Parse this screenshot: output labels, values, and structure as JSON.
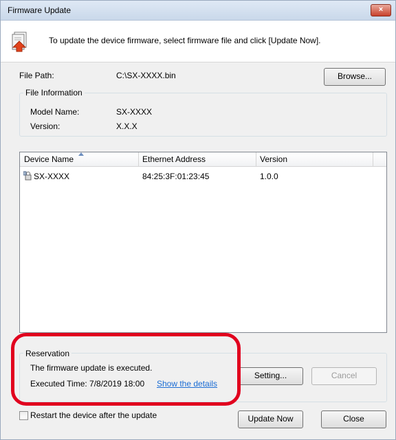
{
  "window": {
    "title": "Firmware Update",
    "close_label": "×"
  },
  "header": {
    "instruction": "To update the device firmware, select firmware file and click [Update Now]."
  },
  "file_path": {
    "label": "File Path:",
    "value": "C:\\SX-XXXX.bin",
    "browse_label": "Browse..."
  },
  "file_info": {
    "title": "File Information",
    "model_label": "Model Name:",
    "model_value": "SX-XXXX",
    "version_label": "Version:",
    "version_value": "X.X.X"
  },
  "device_list": {
    "columns": [
      "Device Name",
      "Ethernet Address",
      "Version"
    ],
    "rows": [
      {
        "name": "SX-XXXX",
        "mac": "84:25:3F:01:23:45",
        "version": "1.0.0"
      }
    ]
  },
  "reservation": {
    "title": "Reservation",
    "status": "The firmware update is executed.",
    "executed_time": "Executed Time: 7/8/2019 18:00",
    "details_link": "Show the details",
    "setting_label": "Setting...",
    "cancel_label": "Cancel"
  },
  "footer": {
    "restart_label": "Restart the device after the update",
    "restart_checked": false,
    "update_label": "Update Now",
    "close_label": "Close"
  },
  "colors": {
    "highlight": "#e1001e",
    "link": "#1a6cd4"
  }
}
